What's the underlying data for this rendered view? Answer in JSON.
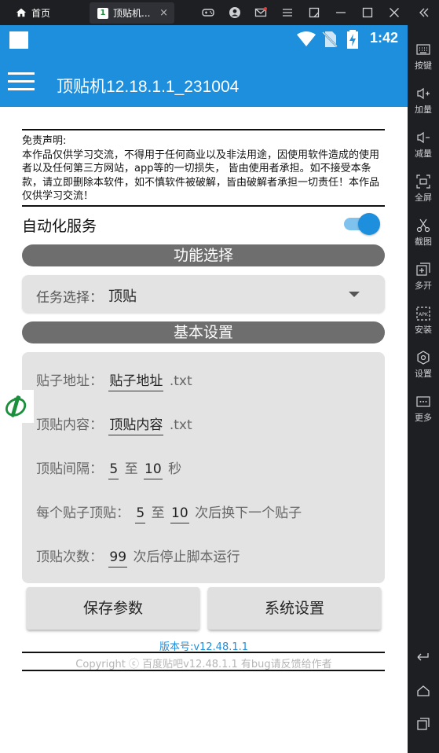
{
  "emulator": {
    "home_tab_label": "首页",
    "app_tab_label": "顶贴机...",
    "app_tab_close": "×",
    "sidebar": [
      {
        "label": "按键",
        "icon": "keyboard-icon"
      },
      {
        "label": "加量",
        "icon": "volume-up-icon"
      },
      {
        "label": "减量",
        "icon": "volume-down-icon"
      },
      {
        "label": "全屏",
        "icon": "fullscreen-icon"
      },
      {
        "label": "截图",
        "icon": "scissors-icon"
      },
      {
        "label": "多开",
        "icon": "multi-open-icon"
      },
      {
        "label": "安装",
        "icon": "apk-install-icon"
      },
      {
        "label": "设置",
        "icon": "gear-icon"
      },
      {
        "label": "更多",
        "icon": "more-icon"
      }
    ]
  },
  "status_bar": {
    "time": "1:42"
  },
  "app_bar": {
    "title": "顶贴机12.18.1.1_231004"
  },
  "disclaimer": {
    "title": "免责声明:",
    "body": "本作品仅供学习交流，不得用于任何商业以及非法用途，因使用软件造成的使用者以及任何第三方网站，app等的一切损失， 皆由使用者承担。如不接受本条款，请立即删除本软件，如不慎软件被破解，皆由破解者承担一切责任！本作品仅供学习交流！"
  },
  "automation": {
    "label": "自动化服务",
    "enabled": true
  },
  "function_section": {
    "header": "功能选择",
    "task_label": "任务选择：",
    "task_value": "顶贴"
  },
  "basic_section": {
    "header": "基本设置",
    "post_address": {
      "label": "贴子地址：",
      "value": "贴子地址",
      "suffix": ".txt"
    },
    "post_content": {
      "label": "顶贴内容：",
      "value": "顶贴内容",
      "suffix": ".txt"
    },
    "interval": {
      "label": "顶贴间隔：",
      "min": "5",
      "to": "至",
      "max": "10",
      "unit": "秒"
    },
    "per_post": {
      "label": "每个贴子顶贴：",
      "min": "5",
      "to": "至",
      "max": "10",
      "suffix": "次后换下一个贴子"
    },
    "count": {
      "label": "顶贴次数：",
      "value": "99",
      "suffix": "次后停止脚本运行"
    }
  },
  "buttons": {
    "save": "保存参数",
    "system": "系统设置"
  },
  "footer": {
    "version": "版本号:v12.48.1.1",
    "copyright": "Copyright ⓒ 百度贴吧v12.48.1.1  有bug请反馈给作者"
  },
  "colors": {
    "primary": "#1e8fdd",
    "section_header": "#6e6e6e",
    "panel": "#e3e3e3",
    "emulator_chrome": "#1e1f22"
  }
}
